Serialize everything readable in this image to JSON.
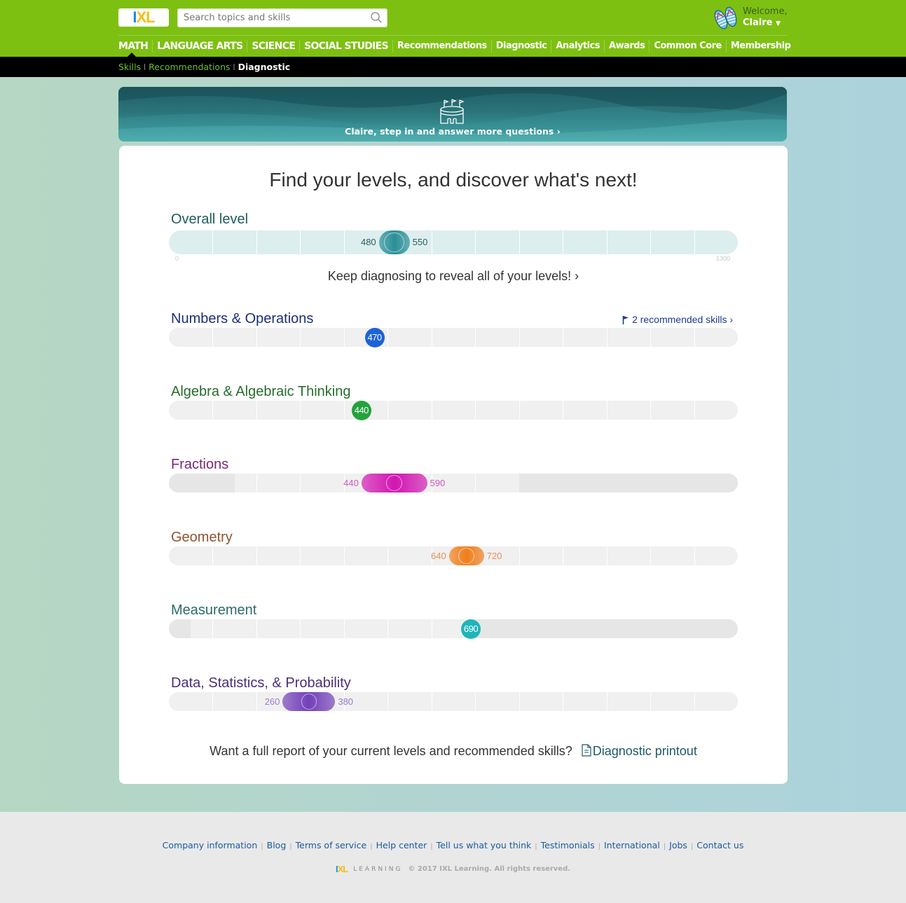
{
  "header": {
    "logo": {
      "i": "I",
      "xl": "XL"
    },
    "search_placeholder": "Search topics and skills",
    "welcome_label": "Welcome,",
    "user_name": "Claire",
    "nav": [
      {
        "label": "MATH",
        "type": "subject",
        "active": true
      },
      {
        "label": "LANGUAGE ARTS",
        "type": "subject"
      },
      {
        "label": "SCIENCE",
        "type": "subject"
      },
      {
        "label": "SOCIAL STUDIES",
        "type": "subject"
      },
      {
        "label": "Recommendations",
        "type": "page"
      },
      {
        "label": "Diagnostic",
        "type": "page"
      },
      {
        "label": "Analytics",
        "type": "page"
      },
      {
        "label": "Awards",
        "type": "page"
      },
      {
        "label": "Common Core",
        "type": "page"
      },
      {
        "label": "Membership",
        "type": "page"
      }
    ],
    "subnav": {
      "items": [
        "Skills",
        "Recommendations"
      ],
      "current": "Diagnostic"
    }
  },
  "banner": {
    "message": "Claire, step in and answer more questions ›"
  },
  "main": {
    "title": "Find your levels, and discover what's next!",
    "scale": {
      "min": 0,
      "max": 1300,
      "min_label": "0",
      "max_label": "1300",
      "columns": 13
    },
    "overall": {
      "title": "Overall level",
      "low": 480,
      "high": 550,
      "low_label": "480",
      "high_label": "550",
      "color": "#2a8f97",
      "title_color": "#1f5c5e",
      "track_color": "#ddeeee"
    },
    "keep_diagnosing": "Keep diagnosing to reveal all of your levels! ›",
    "recommended": {
      "label": "2 recommended skills ›"
    },
    "strands": [
      {
        "title": "Numbers & Operations",
        "value": 470,
        "label": "470",
        "color": "#1d62d6",
        "title_color": "#1b2f77",
        "known_range": [
          0,
          1300
        ],
        "type": "dot"
      },
      {
        "title": "Algebra & Algebraic Thinking",
        "value": 440,
        "label": "440",
        "color": "#22a33b",
        "title_color": "#276d2c",
        "known_range": [
          0,
          1300
        ],
        "type": "dot"
      },
      {
        "title": "Fractions",
        "low": 440,
        "high": 590,
        "low_label": "440",
        "high_label": "590",
        "color": "#d116b1",
        "label_color": "#d058c0",
        "title_color": "#7b2870",
        "known_range": [
          150,
          800
        ],
        "type": "range"
      },
      {
        "title": "Geometry",
        "low": 640,
        "high": 720,
        "low_label": "640",
        "high_label": "720",
        "color": "#f07e1c",
        "label_color": "#e8905a",
        "title_color": "#8f5430",
        "known_range": [
          0,
          1300
        ],
        "type": "range"
      },
      {
        "title": "Measurement",
        "value": 690,
        "label": "690",
        "color": "#1fb5b9",
        "title_color": "#2f6a6a",
        "known_range": [
          50,
          700
        ],
        "type": "dot"
      },
      {
        "title": "Data, Statistics, & Probability",
        "low": 260,
        "high": 380,
        "low_label": "260",
        "high_label": "380",
        "color": "#7340b9",
        "label_color": "#9a7bcf",
        "title_color": "#4d2f78",
        "known_range": [
          0,
          1300
        ],
        "type": "range"
      }
    ],
    "report_question": "Want a full report of your current levels and recommended skills?",
    "report_link": "Diagnostic printout"
  },
  "footer": {
    "links": [
      "Company information",
      "Blog",
      "Terms of service",
      "Help center",
      "Tell us what you think",
      "Testimonials",
      "International",
      "Jobs",
      "Contact us"
    ],
    "learning": "LEARNING",
    "copyright": "© 2017 IXL Learning. All rights reserved."
  }
}
